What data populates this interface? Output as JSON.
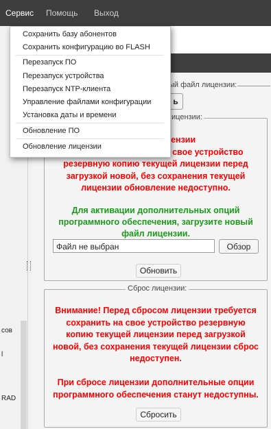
{
  "menubar": {
    "items": [
      "Сервис",
      "Помощь",
      "Выход"
    ]
  },
  "dropdown": {
    "items": [
      "Сохранить базу абонентов",
      "Сохранить конфигурацию во FLASH",
      "Перезапуск ПО",
      "Перезапуск устройства",
      "Перезапуск NTP-клиента",
      "Управление файлами конфигурации",
      "Установка даты и времени",
      "Обновление ПО",
      "Обновление лицензии"
    ]
  },
  "background_fragments": {
    "license_file_legend": "ый файл лицензии:",
    "license_legend_frag": "ицензии:",
    "button_stub": "ь",
    "left1": "сов",
    "left2": "l",
    "left3": "RAD"
  },
  "update_section": {
    "warning_lines": [
      "влением лицензии",
      "требуется сохранить на свое устройство",
      "резервную копию текущей лицензии перед",
      "загрузкой новой, без сохранения текущей",
      "лицензии обновление недоступно."
    ],
    "info_lines": [
      "Для активации дополнительных опций",
      "программного обеспечения, загрузите новый",
      "файл лицензии."
    ],
    "file_value": "Файл не выбран",
    "browse_label": "Обзор",
    "update_label": "Обновить"
  },
  "reset_section": {
    "legend": "Сброс лицензии:",
    "warning_lines": [
      "Внимание! Перед сбросом лицензии требуется",
      "сохранить на свое устройство резервную",
      "копию текущей лицензии перед загрузкой",
      "новой, без сохранения текущей лицензии сброс",
      "недоступен.",
      "",
      "При сбросе лицензии дополнительные опции",
      "программного обеспечения станут недоступны."
    ],
    "reset_label": "Сбросить"
  },
  "colors": {
    "menubar_bg": "#3e3e3e",
    "warning": "#ff0000",
    "info": "#1a9b1a"
  }
}
